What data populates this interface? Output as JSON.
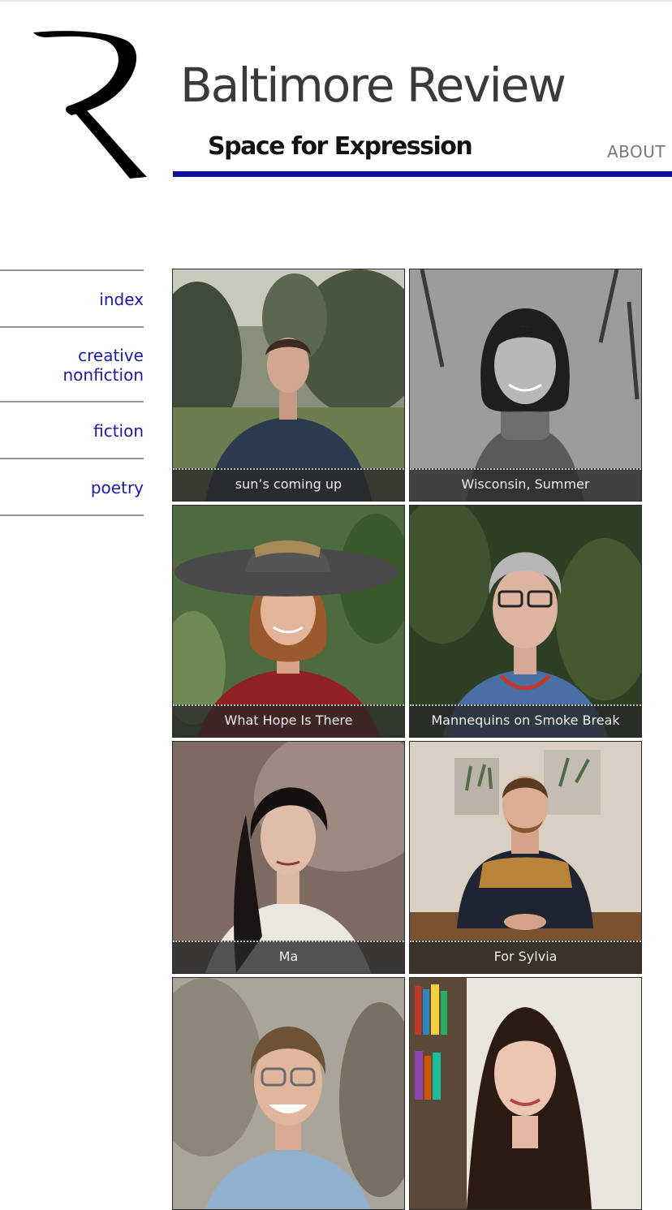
{
  "header": {
    "site_title": "Baltimore Review",
    "tagline": "Space for Expression",
    "nav_about": "ABOUT",
    "rule_color": "#10109a"
  },
  "sidebar": {
    "link_color": "#1a1aa6",
    "items": [
      {
        "lines": [
          "index"
        ]
      },
      {
        "lines": [
          "creative",
          "nonfiction"
        ]
      },
      {
        "lines": [
          "fiction"
        ]
      },
      {
        "lines": [
          "poetry"
        ]
      }
    ]
  },
  "grid": {
    "tiles": [
      {
        "caption": "sun’s coming up"
      },
      {
        "caption": "Wisconsin, Summer"
      },
      {
        "caption": "What Hope Is There"
      },
      {
        "caption": "Mannequins on Smoke Break"
      },
      {
        "caption": "Ma"
      },
      {
        "caption": "For Sylvia"
      },
      {
        "caption": ""
      },
      {
        "caption": ""
      }
    ]
  }
}
